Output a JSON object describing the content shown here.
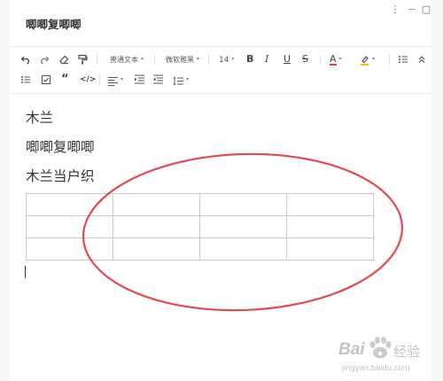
{
  "document": {
    "title": "唧唧复唧唧",
    "paragraphs": [
      "木兰",
      "唧唧复唧唧",
      "木兰当户织"
    ],
    "table": {
      "rows": 3,
      "cols": 4,
      "cells": [
        [
          "",
          "",
          "",
          ""
        ],
        [
          "",
          "",
          "",
          ""
        ],
        [
          "",
          "",
          "",
          ""
        ]
      ]
    }
  },
  "window_controls": {
    "more": "⋮",
    "minimize": "—",
    "maximize": "▢"
  },
  "toolbar": {
    "row1": {
      "undo_icon": "undo-icon",
      "redo_icon": "redo-icon",
      "eraser_icon": "eraser-icon",
      "format_painter_icon": "format-painter-icon",
      "paragraph_style": "普通文本",
      "font_family": "微软雅黑",
      "font_size": "14",
      "bold": "B",
      "italic": "I",
      "underline": "U",
      "strike": "S",
      "font_color_label": "A",
      "font_color": "#e03e2d",
      "highlight_color": "#f5c400"
    },
    "row2": {
      "checklist_icon": "checklist-icon",
      "checkbox_icon": "checkbox-icon",
      "quote": "“",
      "code": "</>"
    }
  },
  "annotation": {
    "color": "#e5484d"
  },
  "watermark": {
    "brand": "Bai",
    "brand_suffix": "经验",
    "url": "jingyan.baidu.com"
  }
}
